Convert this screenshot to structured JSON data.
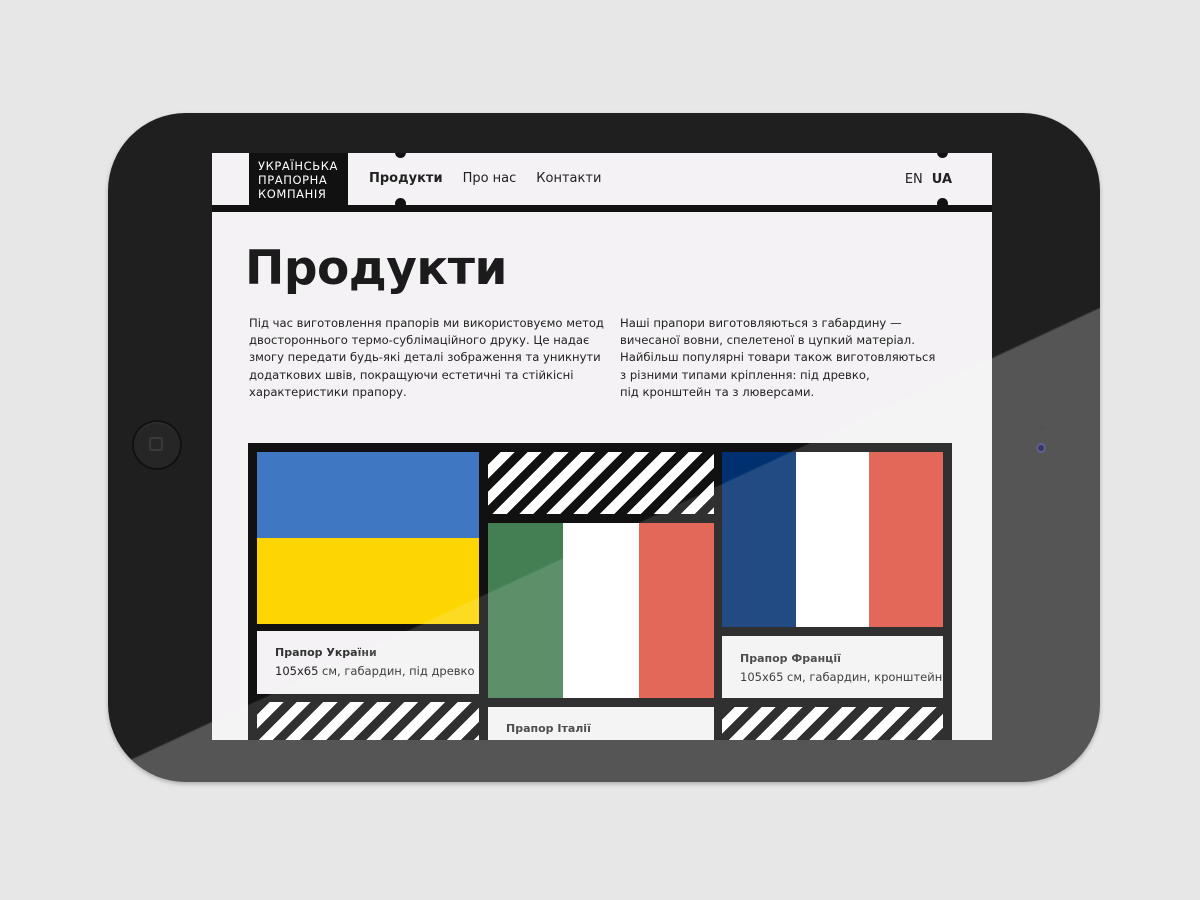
{
  "header": {
    "logo_lines": [
      "УКРАЇНСЬКА",
      "ПРАПОРНА",
      "КОМПАНІЯ"
    ],
    "nav": [
      {
        "label": "Продукти",
        "active": true
      },
      {
        "label": "Про нас",
        "active": false
      },
      {
        "label": "Контакти",
        "active": false
      }
    ],
    "languages": [
      {
        "label": "EN",
        "active": false
      },
      {
        "label": "UA",
        "active": true
      }
    ]
  },
  "main": {
    "title": "Продукти",
    "intro_left": [
      "Під час виготовлення прапорів ми використовуємо метод",
      "двостороннього термо-сублімаційного друку. Це надає",
      "змогу передати будь-які деталі зображення та уникнути",
      "додаткових швів, покращуючи естетичні та стійкісні",
      "характеристики прапору."
    ],
    "intro_right": [
      "Наші прапори виготовляються з габардину —",
      "вичесаної вовни, спелетеної в цупкий матеріал.",
      "Найбільш популярні товари також виготовляються",
      "з різними типами кріплення: під древко,",
      "під кронштейн та з люверсами."
    ]
  },
  "products": [
    {
      "title": "Прапор України",
      "desc": "105x65 см, габардин, під древко",
      "colors": [
        "#3f77c2",
        "#fdd601"
      ]
    },
    {
      "title": "Прапор Італії",
      "desc": "",
      "colors": [
        "#437f52",
        "#ffffff",
        "#e05142"
      ]
    },
    {
      "title": "Прапор Франції",
      "desc": "105x65 см, габардин, кронштейн",
      "colors": [
        "#00306f",
        "#ffffff",
        "#e05142"
      ]
    }
  ]
}
